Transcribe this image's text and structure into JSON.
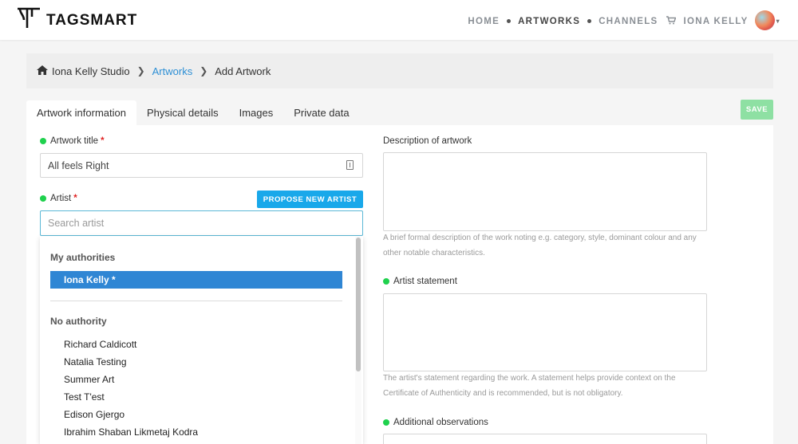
{
  "brand": {
    "name": "TAGSMART"
  },
  "nav": {
    "items": [
      "HOME",
      "ARTWORKS",
      "CHANNELS"
    ],
    "active": "ARTWORKS",
    "user_name": "IONA KELLY"
  },
  "breadcrumb": {
    "studio": "Iona Kelly Studio",
    "section": "Artworks",
    "current": "Add Artwork"
  },
  "tabs": [
    "Artwork information",
    "Physical details",
    "Images",
    "Private data"
  ],
  "active_tab": "Artwork information",
  "save_label": "SAVE",
  "form": {
    "title_label": "Artwork title",
    "title_value": "All feels Right",
    "artist_label": "Artist",
    "propose_label": "PROPOSE NEW ARTIST",
    "artist_placeholder": "Search artist",
    "description_label": "Description of artwork",
    "description_help": "A brief formal description of the work noting e.g. category, style, dominant colour and any other notable characteristics.",
    "statement_label": "Artist statement",
    "statement_help": "The artist's statement regarding the work. A statement helps provide context on the Certificate of Authenticity and is recommended, but is not obligatory.",
    "observations_label": "Additional observations"
  },
  "dropdown": {
    "group_authorities": "My authorities",
    "selected_authority": "Iona Kelly *",
    "group_no_authority": "No authority",
    "no_authority_items": [
      "Richard Caldicott",
      "Natalia Testing",
      "Summer Art",
      "Test T'est",
      "Edison Gjergo",
      "Ibrahim Shaban Likmetaj Kodra"
    ]
  },
  "icons": {
    "home": "home-icon",
    "cart": "cart-icon",
    "chevron": "chevron-right-icon"
  },
  "colors": {
    "accent_blue": "#19a8ea",
    "selected_blue": "#2f86d4",
    "save_green": "#8ee0a3",
    "status_green": "#1fd14d",
    "link_blue": "#2d8fd5"
  }
}
